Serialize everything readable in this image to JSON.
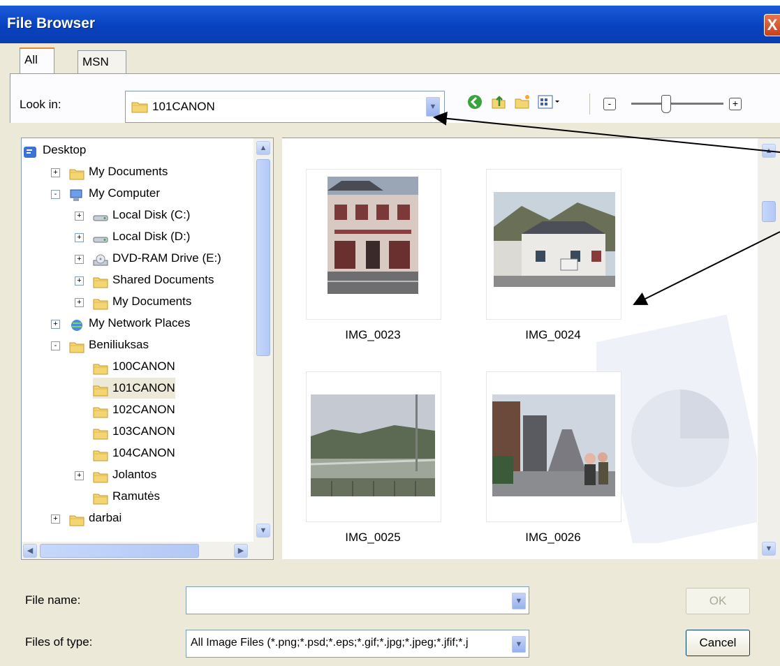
{
  "window": {
    "title": "File Browser",
    "close_label": "X"
  },
  "tabs": [
    {
      "label": "All Files"
    },
    {
      "label": "MSN Groups"
    }
  ],
  "lookin": {
    "label": "Look in:",
    "value": "101CANON"
  },
  "zoom": {
    "minus": "-",
    "plus": "+",
    "level": 0.33
  },
  "tree": {
    "items": [
      {
        "label": "Desktop",
        "icon": "desktop-icon",
        "expander": ""
      },
      {
        "label": "My Documents",
        "icon": "folder-icon",
        "expander": "+"
      },
      {
        "label": "My Computer",
        "icon": "computer-icon",
        "expander": "-"
      },
      {
        "label": "Local Disk (C:)",
        "icon": "drive-icon",
        "expander": "+"
      },
      {
        "label": "Local Disk (D:)",
        "icon": "drive-icon",
        "expander": "+"
      },
      {
        "label": "DVD-RAM Drive (E:)",
        "icon": "dvd-icon",
        "expander": "+"
      },
      {
        "label": "Shared Documents",
        "icon": "folder-icon",
        "expander": "+"
      },
      {
        "label": "My Documents",
        "icon": "folder-icon",
        "expander": "+"
      },
      {
        "label": "My Network Places",
        "icon": "network-icon",
        "expander": "+"
      },
      {
        "label": "Beniliuksas",
        "icon": "folder-icon",
        "expander": "-"
      },
      {
        "label": "100CANON",
        "icon": "folder-icon",
        "expander": ""
      },
      {
        "label": "101CANON",
        "icon": "folder-icon",
        "expander": "",
        "selected": true
      },
      {
        "label": "102CANON",
        "icon": "folder-icon",
        "expander": ""
      },
      {
        "label": "103CANON",
        "icon": "folder-icon",
        "expander": ""
      },
      {
        "label": "104CANON",
        "icon": "folder-icon",
        "expander": ""
      },
      {
        "label": "Jolantos",
        "icon": "folder-icon",
        "expander": "+"
      },
      {
        "label": "Ramutės",
        "icon": "folder-icon",
        "expander": ""
      },
      {
        "label": "darbai",
        "icon": "folder-icon",
        "expander": "+"
      }
    ]
  },
  "thumbnails": [
    {
      "name": "IMG_0023"
    },
    {
      "name": "IMG_0024"
    },
    {
      "name": "IMG_0025"
    },
    {
      "name": "IMG_0026"
    }
  ],
  "file_name": {
    "label": "File name:",
    "value": ""
  },
  "file_type": {
    "label": "Files of type:",
    "value": "All Image Files (*.png;*.psd;*.eps;*.gif;*.jpg;*.jpeg;*.jfif;*.j"
  },
  "buttons": {
    "ok": "OK",
    "cancel": "Cancel"
  },
  "colors": {
    "titlebar": "#0842c0",
    "dialog": "#ece9d8",
    "tab_accent": "#e68b2c",
    "folder": "#f3d574"
  }
}
